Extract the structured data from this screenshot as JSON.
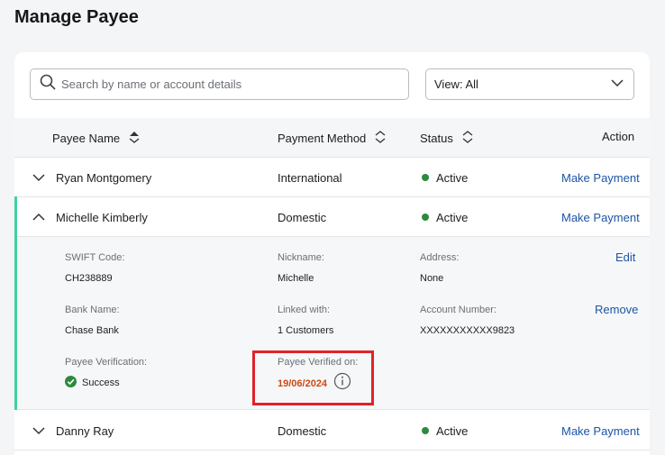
{
  "page": {
    "title": "Manage Payee"
  },
  "search": {
    "placeholder": "Search by name or account details",
    "value": ""
  },
  "view_filter": {
    "label": "View: All"
  },
  "table": {
    "columns": {
      "name": "Payee Name",
      "method": "Payment Method",
      "status": "Status",
      "action": "Action"
    },
    "rows": [
      {
        "name": "Ryan Montgomery",
        "method": "International",
        "status": "Active",
        "action": "Make Payment"
      },
      {
        "name": "Michelle Kimberly",
        "method": "Domestic",
        "status": "Active",
        "action": "Make Payment"
      },
      {
        "name": "Danny Ray",
        "method": "Domestic",
        "status": "Active",
        "action": "Make Payment"
      }
    ]
  },
  "details": {
    "swift_label": "SWIFT Code:",
    "swift_value": "CH238889",
    "nickname_label": "Nickname:",
    "nickname_value": "Michelle",
    "address_label": "Address:",
    "address_value": "None",
    "bank_label": "Bank Name:",
    "bank_value": "Chase Bank",
    "linked_label": "Linked with:",
    "linked_value": "1 Customers",
    "account_label": "Account Number:",
    "account_value": "XXXXXXXXXXX9823",
    "verification_label": "Payee Verification:",
    "verification_value": "Success",
    "verified_on_label": "Payee Verified on:",
    "verified_on_value": "19/06/2024",
    "edit_label": "Edit",
    "remove_label": "Remove"
  },
  "colors": {
    "accent": "#3fd29e",
    "link": "#1c55a6",
    "active": "#2c8a3e",
    "verified_date": "#c94b16",
    "highlight": "#e0222b"
  }
}
